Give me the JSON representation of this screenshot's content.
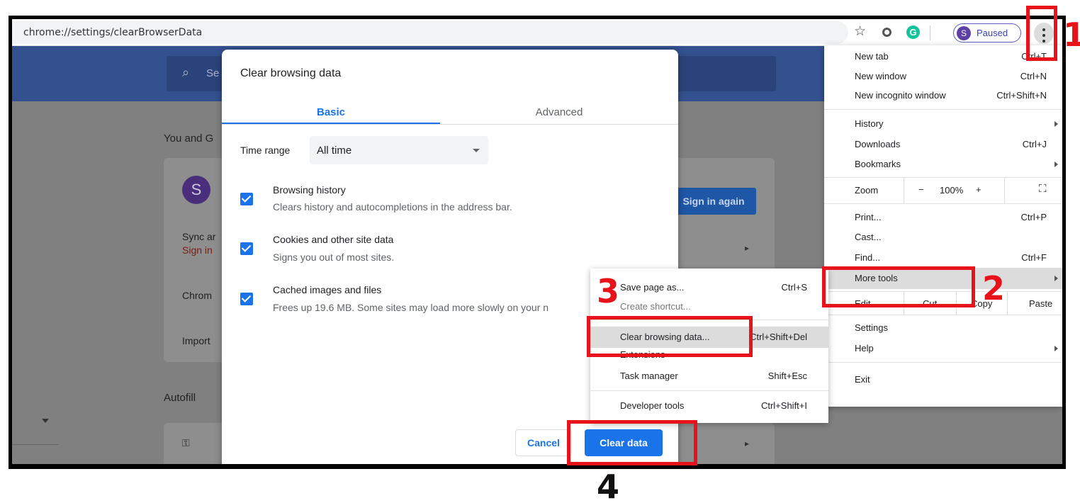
{
  "address_bar": {
    "url": "chrome://settings/clearBrowserData"
  },
  "toolbar": {
    "profile_initial": "S",
    "profile_status": "Paused",
    "grammarly_letter": "G",
    "star": "☆"
  },
  "settings_page": {
    "search_placeholder": "Se",
    "section_you": "You and G",
    "avatar_initial": "S",
    "sign_in_again": "Sign in again",
    "sync_label": "Sync ar",
    "sign_in_label": "Sign in",
    "chrome_label": "Chrom",
    "import_label": "Import",
    "autofill_title": "Autofill"
  },
  "dialog": {
    "title": "Clear browsing data",
    "tabs": {
      "basic": "Basic",
      "advanced": "Advanced"
    },
    "time_range": {
      "label": "Time range",
      "value": "All time"
    },
    "items": [
      {
        "title": "Browsing history",
        "desc": "Clears history and autocompletions in the address bar.",
        "checked": true
      },
      {
        "title": "Cookies and other site data",
        "desc": "Signs you out of most sites.",
        "checked": true
      },
      {
        "title": "Cached images and files",
        "desc": "Frees up 19.6 MB. Some sites may load more slowly on your n",
        "checked": true
      }
    ],
    "cancel": "Cancel",
    "clear_data": "Clear data"
  },
  "main_menu": {
    "new_tab": {
      "label": "New tab",
      "shortcut": "Ctrl+T"
    },
    "new_window": {
      "label": "New window",
      "shortcut": "Ctrl+N"
    },
    "new_incognito": {
      "label": "New incognito window",
      "shortcut": "Ctrl+Shift+N"
    },
    "history": {
      "label": "History"
    },
    "downloads": {
      "label": "Downloads",
      "shortcut": "Ctrl+J"
    },
    "bookmarks": {
      "label": "Bookmarks"
    },
    "zoom": {
      "label": "Zoom",
      "minus": "−",
      "value": "100%",
      "plus": "+"
    },
    "print": {
      "label": "Print...",
      "shortcut": "Ctrl+P"
    },
    "cast": {
      "label": "Cast..."
    },
    "find": {
      "label": "Find...",
      "shortcut": "Ctrl+F"
    },
    "more_tools": {
      "label": "More tools"
    },
    "edit": {
      "label": "Edit",
      "cut": "Cut",
      "copy": "Copy",
      "paste": "Paste"
    },
    "settings": {
      "label": "Settings"
    },
    "help": {
      "label": "Help"
    },
    "exit": {
      "label": "Exit"
    }
  },
  "more_tools_menu": {
    "save_page": {
      "label": "Save page as...",
      "shortcut": "Ctrl+S"
    },
    "create_shortcut": {
      "label": "Create shortcut..."
    },
    "clear_browsing": {
      "label": "Clear browsing data...",
      "shortcut": "Ctrl+Shift+Del"
    },
    "extensions": {
      "label": "Extensions"
    },
    "task_manager": {
      "label": "Task manager",
      "shortcut": "Shift+Esc"
    },
    "developer_tools": {
      "label": "Developer tools",
      "shortcut": "Ctrl+Shift+I"
    }
  },
  "annotations": {
    "step1": "1",
    "step2": "2",
    "step3": "3",
    "step4": "4",
    "highlight_color": "#e8121a"
  }
}
